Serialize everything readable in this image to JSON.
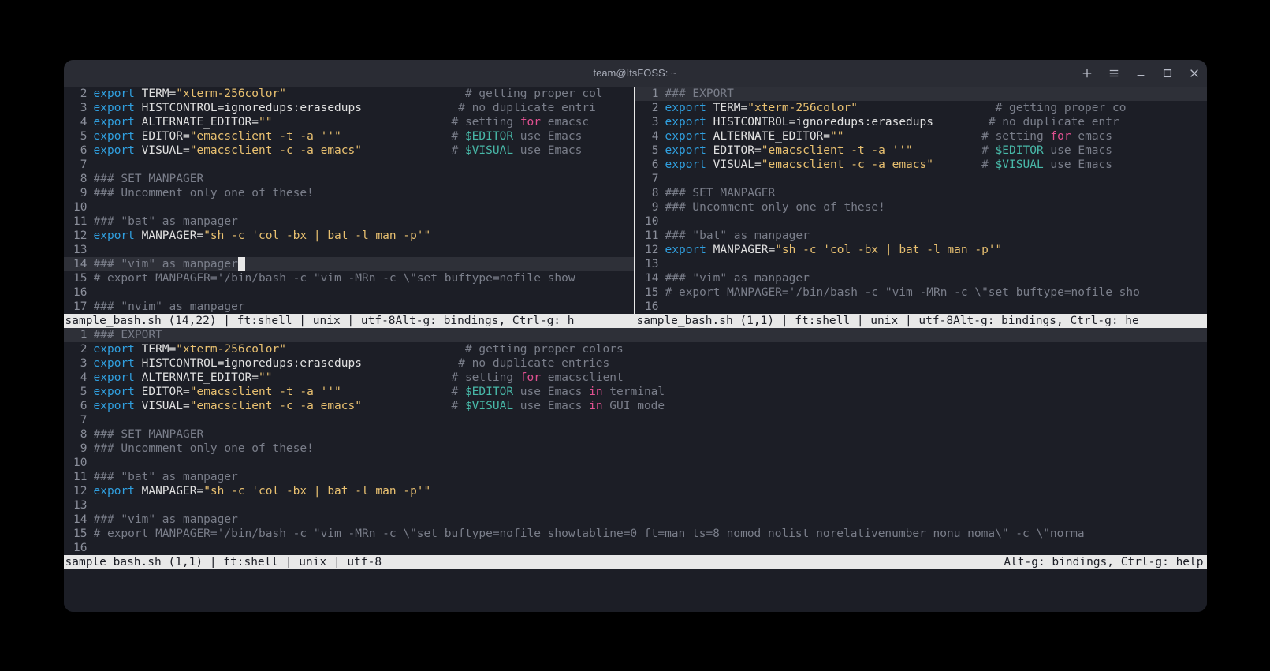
{
  "window": {
    "title": "team@ItsFOSS: ~"
  },
  "status": {
    "top_left": "sample_bash.sh (14,22) | ft:shell | unix | utf-8Alt-g: bindings, Ctrl-g: h",
    "top_right": "sample_bash.sh (1,1) | ft:shell | unix | utf-8Alt-g: bindings, Ctrl-g: he",
    "bottom_left": "sample_bash.sh (1,1) | ft:shell | unix | utf-8",
    "bottom_right": "Alt-g: bindings, Ctrl-g: help"
  },
  "lines_top_left": [
    {
      "n": "2",
      "seg": [
        [
          "export ",
          "kw-export"
        ],
        [
          "TERM",
          "kw-var"
        ],
        [
          "=",
          "kw-var"
        ],
        [
          "\"xterm-256color\"",
          "kw-str"
        ],
        [
          "                          ",
          ""
        ],
        [
          "# getting proper col",
          "kw-cmt"
        ]
      ]
    },
    {
      "n": "3",
      "seg": [
        [
          "export ",
          "kw-export"
        ],
        [
          "HISTCONTROL",
          "kw-var"
        ],
        [
          "=ignoredups:erasedups",
          "kw-var"
        ],
        [
          "              ",
          ""
        ],
        [
          "# no duplicate entri",
          "kw-cmt"
        ]
      ]
    },
    {
      "n": "4",
      "seg": [
        [
          "export ",
          "kw-export"
        ],
        [
          "ALTERNATE_EDITOR",
          "kw-var"
        ],
        [
          "=",
          "kw-var"
        ],
        [
          "\"\"",
          "kw-str"
        ],
        [
          "                          ",
          ""
        ],
        [
          "# setting ",
          "kw-cmt"
        ],
        [
          "for",
          "kw-for"
        ],
        [
          " emacsc",
          "kw-cmt"
        ]
      ]
    },
    {
      "n": "5",
      "seg": [
        [
          "export ",
          "kw-export"
        ],
        [
          "EDITOR",
          "kw-var"
        ],
        [
          "=",
          "kw-var"
        ],
        [
          "\"emacsclient -t -a ''\"",
          "kw-str"
        ],
        [
          "                ",
          ""
        ],
        [
          "# ",
          "kw-cmt"
        ],
        [
          "$EDITOR",
          "kw-dollar"
        ],
        [
          " use Emacs ",
          "kw-cmt"
        ]
      ]
    },
    {
      "n": "6",
      "seg": [
        [
          "export ",
          "kw-export"
        ],
        [
          "VISUAL",
          "kw-var"
        ],
        [
          "=",
          "kw-var"
        ],
        [
          "\"emacsclient -c -a emacs\"",
          "kw-str"
        ],
        [
          "             ",
          ""
        ],
        [
          "# ",
          "kw-cmt"
        ],
        [
          "$VISUAL",
          "kw-dollar"
        ],
        [
          " use Emacs ",
          "kw-cmt"
        ]
      ]
    },
    {
      "n": "7",
      "seg": [
        [
          "",
          ""
        ]
      ]
    },
    {
      "n": "8",
      "seg": [
        [
          "### SET MANPAGER",
          "kw-cmt"
        ]
      ]
    },
    {
      "n": "9",
      "seg": [
        [
          "### Uncomment only one of these!",
          "kw-cmt"
        ]
      ]
    },
    {
      "n": "10",
      "seg": [
        [
          "",
          ""
        ]
      ]
    },
    {
      "n": "11",
      "seg": [
        [
          "### \"bat\" as manpager",
          "kw-cmt"
        ]
      ]
    },
    {
      "n": "12",
      "seg": [
        [
          "export ",
          "kw-export"
        ],
        [
          "MANPAGER",
          "kw-var"
        ],
        [
          "=",
          "kw-var"
        ],
        [
          "\"sh -c 'col -bx | bat -l man -p'\"",
          "kw-str"
        ]
      ]
    },
    {
      "n": "13",
      "seg": [
        [
          "",
          ""
        ]
      ]
    },
    {
      "n": "14",
      "seg": [
        [
          "### \"vim\" as manpager",
          "kw-cmt"
        ]
      ],
      "hl": true,
      "cursor_after": true
    },
    {
      "n": "15",
      "seg": [
        [
          "# export MANPAGER='/bin/bash -c \"vim -MRn -c \\\"set buftype=nofile show",
          "kw-cmt"
        ]
      ]
    },
    {
      "n": "16",
      "seg": [
        [
          "",
          ""
        ]
      ]
    },
    {
      "n": "17",
      "seg": [
        [
          "### \"nvim\" as manpager",
          "kw-cmt"
        ]
      ]
    }
  ],
  "lines_top_right": [
    {
      "n": "1",
      "seg": [
        [
          "### EXPORT",
          "kw-cmt"
        ]
      ],
      "hl": true
    },
    {
      "n": "2",
      "seg": [
        [
          "export ",
          "kw-export"
        ],
        [
          "TERM",
          "kw-var"
        ],
        [
          "=",
          "kw-var"
        ],
        [
          "\"xterm-256color\"",
          "kw-str"
        ],
        [
          "                    ",
          ""
        ],
        [
          "# getting proper co",
          "kw-cmt"
        ]
      ]
    },
    {
      "n": "3",
      "seg": [
        [
          "export ",
          "kw-export"
        ],
        [
          "HISTCONTROL",
          "kw-var"
        ],
        [
          "=ignoredups:erasedups",
          "kw-var"
        ],
        [
          "        ",
          ""
        ],
        [
          "# no duplicate entr",
          "kw-cmt"
        ]
      ]
    },
    {
      "n": "4",
      "seg": [
        [
          "export ",
          "kw-export"
        ],
        [
          "ALTERNATE_EDITOR",
          "kw-var"
        ],
        [
          "=",
          "kw-var"
        ],
        [
          "\"\"",
          "kw-str"
        ],
        [
          "                    ",
          ""
        ],
        [
          "# setting ",
          "kw-cmt"
        ],
        [
          "for",
          "kw-for"
        ],
        [
          " emacs",
          "kw-cmt"
        ]
      ]
    },
    {
      "n": "5",
      "seg": [
        [
          "export ",
          "kw-export"
        ],
        [
          "EDITOR",
          "kw-var"
        ],
        [
          "=",
          "kw-var"
        ],
        [
          "\"emacsclient -t -a ''\"",
          "kw-str"
        ],
        [
          "          ",
          ""
        ],
        [
          "# ",
          "kw-cmt"
        ],
        [
          "$EDITOR",
          "kw-dollar"
        ],
        [
          " use Emacs",
          "kw-cmt"
        ]
      ]
    },
    {
      "n": "6",
      "seg": [
        [
          "export ",
          "kw-export"
        ],
        [
          "VISUAL",
          "kw-var"
        ],
        [
          "=",
          "kw-var"
        ],
        [
          "\"emacsclient -c -a emacs\"",
          "kw-str"
        ],
        [
          "       ",
          ""
        ],
        [
          "# ",
          "kw-cmt"
        ],
        [
          "$VISUAL",
          "kw-dollar"
        ],
        [
          " use Emacs",
          "kw-cmt"
        ]
      ]
    },
    {
      "n": "7",
      "seg": [
        [
          "",
          ""
        ]
      ]
    },
    {
      "n": "8",
      "seg": [
        [
          "### SET MANPAGER",
          "kw-cmt"
        ]
      ]
    },
    {
      "n": "9",
      "seg": [
        [
          "### Uncomment only one of these!",
          "kw-cmt"
        ]
      ]
    },
    {
      "n": "10",
      "seg": [
        [
          "",
          ""
        ]
      ]
    },
    {
      "n": "11",
      "seg": [
        [
          "### \"bat\" as manpager",
          "kw-cmt"
        ]
      ]
    },
    {
      "n": "12",
      "seg": [
        [
          "export ",
          "kw-export"
        ],
        [
          "MANPAGER",
          "kw-var"
        ],
        [
          "=",
          "kw-var"
        ],
        [
          "\"sh -c 'col -bx | bat -l man -p'\"",
          "kw-str"
        ]
      ]
    },
    {
      "n": "13",
      "seg": [
        [
          "",
          ""
        ]
      ]
    },
    {
      "n": "14",
      "seg": [
        [
          "### \"vim\" as manpager",
          "kw-cmt"
        ]
      ]
    },
    {
      "n": "15",
      "seg": [
        [
          "# export MANPAGER='/bin/bash -c \"vim -MRn -c \\\"set buftype=nofile sho",
          "kw-cmt"
        ]
      ]
    },
    {
      "n": "16",
      "seg": [
        [
          "",
          ""
        ]
      ]
    }
  ],
  "lines_bottom": [
    {
      "n": "1",
      "seg": [
        [
          "### EXPORT",
          "kw-cmt"
        ]
      ],
      "hl": true
    },
    {
      "n": "2",
      "seg": [
        [
          "export ",
          "kw-export"
        ],
        [
          "TERM",
          "kw-var"
        ],
        [
          "=",
          "kw-var"
        ],
        [
          "\"xterm-256color\"",
          "kw-str"
        ],
        [
          "                          ",
          ""
        ],
        [
          "# getting proper colors",
          "kw-cmt"
        ]
      ]
    },
    {
      "n": "3",
      "seg": [
        [
          "export ",
          "kw-export"
        ],
        [
          "HISTCONTROL",
          "kw-var"
        ],
        [
          "=ignoredups:erasedups",
          "kw-var"
        ],
        [
          "              ",
          ""
        ],
        [
          "# no duplicate entries",
          "kw-cmt"
        ]
      ]
    },
    {
      "n": "4",
      "seg": [
        [
          "export ",
          "kw-export"
        ],
        [
          "ALTERNATE_EDITOR",
          "kw-var"
        ],
        [
          "=",
          "kw-var"
        ],
        [
          "\"\"",
          "kw-str"
        ],
        [
          "                          ",
          ""
        ],
        [
          "# setting ",
          "kw-cmt"
        ],
        [
          "for",
          "kw-for"
        ],
        [
          " emacsclient",
          "kw-cmt"
        ]
      ]
    },
    {
      "n": "5",
      "seg": [
        [
          "export ",
          "kw-export"
        ],
        [
          "EDITOR",
          "kw-var"
        ],
        [
          "=",
          "kw-var"
        ],
        [
          "\"emacsclient -t -a ''\"",
          "kw-str"
        ],
        [
          "                ",
          ""
        ],
        [
          "# ",
          "kw-cmt"
        ],
        [
          "$EDITOR",
          "kw-dollar"
        ],
        [
          " use Emacs ",
          "kw-cmt"
        ],
        [
          "in",
          "kw-in"
        ],
        [
          " terminal",
          "kw-cmt"
        ]
      ]
    },
    {
      "n": "6",
      "seg": [
        [
          "export ",
          "kw-export"
        ],
        [
          "VISUAL",
          "kw-var"
        ],
        [
          "=",
          "kw-var"
        ],
        [
          "\"emacsclient -c -a emacs\"",
          "kw-str"
        ],
        [
          "             ",
          ""
        ],
        [
          "# ",
          "kw-cmt"
        ],
        [
          "$VISUAL",
          "kw-dollar"
        ],
        [
          " use Emacs ",
          "kw-cmt"
        ],
        [
          "in",
          "kw-in"
        ],
        [
          " GUI mode",
          "kw-cmt"
        ]
      ]
    },
    {
      "n": "7",
      "seg": [
        [
          "",
          ""
        ]
      ]
    },
    {
      "n": "8",
      "seg": [
        [
          "### SET MANPAGER",
          "kw-cmt"
        ]
      ]
    },
    {
      "n": "9",
      "seg": [
        [
          "### Uncomment only one of these!",
          "kw-cmt"
        ]
      ]
    },
    {
      "n": "10",
      "seg": [
        [
          "",
          ""
        ]
      ]
    },
    {
      "n": "11",
      "seg": [
        [
          "### \"bat\" as manpager",
          "kw-cmt"
        ]
      ]
    },
    {
      "n": "12",
      "seg": [
        [
          "export ",
          "kw-export"
        ],
        [
          "MANPAGER",
          "kw-var"
        ],
        [
          "=",
          "kw-var"
        ],
        [
          "\"sh -c 'col -bx | bat -l man -p'\"",
          "kw-str"
        ]
      ]
    },
    {
      "n": "13",
      "seg": [
        [
          "",
          ""
        ]
      ]
    },
    {
      "n": "14",
      "seg": [
        [
          "### \"vim\" as manpager",
          "kw-cmt"
        ]
      ]
    },
    {
      "n": "15",
      "seg": [
        [
          "# export MANPAGER='/bin/bash -c \"vim -MRn -c \\\"set buftype=nofile showtabline=0 ft=man ts=8 nomod nolist norelativenumber nonu noma\\\" -c \\\"norma",
          "kw-cmt"
        ]
      ]
    },
    {
      "n": "16",
      "seg": [
        [
          "",
          ""
        ]
      ]
    }
  ]
}
